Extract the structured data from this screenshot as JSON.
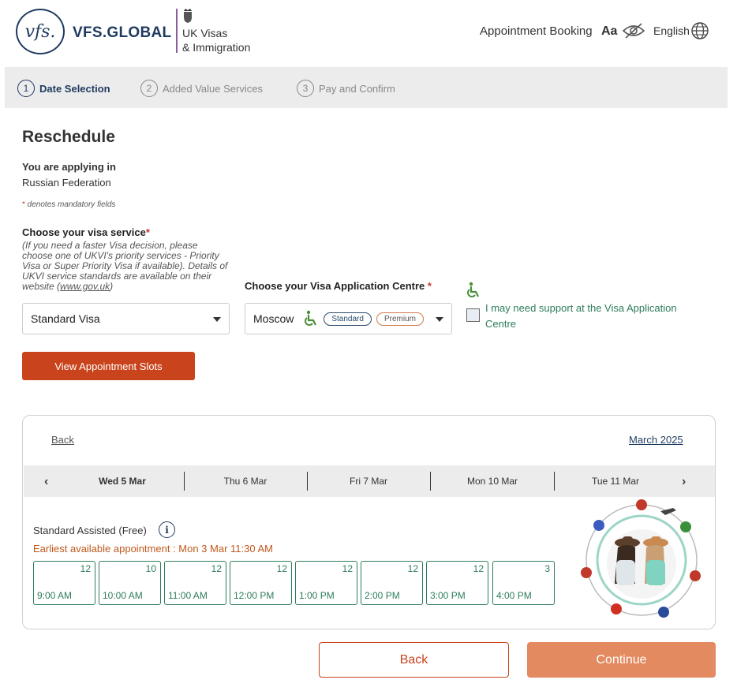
{
  "header": {
    "logo_text": "vfs.",
    "brand": "VFS.GLOBAL",
    "partner_line1": "UK Visas",
    "partner_line2": "& Immigration",
    "appointment_booking": "Appointment Booking",
    "font_size_control": "Aa",
    "language": "English"
  },
  "steps": [
    {
      "num": "1",
      "label": "Date Selection",
      "active": true
    },
    {
      "num": "2",
      "label": "Added Value Services",
      "active": false
    },
    {
      "num": "3",
      "label": "Pay and Confirm",
      "active": false
    }
  ],
  "form": {
    "title": "Reschedule",
    "applying_label": "You are applying in",
    "applying_value": "Russian Federation",
    "mandatory_star": "*",
    "mandatory_note": " denotes mandatory fields",
    "service_label": "Choose your visa service",
    "required_mark": "*",
    "service_note_pre": "(If you need a faster Visa decision, please choose one of UKVI's priority services - Priority Visa or Super Priority Visa if available). Details of UKVI service standards are available on their website (",
    "service_note_link": "www.gov.uk",
    "service_note_post": ")",
    "service_value": "Standard Visa",
    "vac_label": "Choose your Visa Application Centre",
    "vac_value": "Moscow",
    "vac_pill_standard": "Standard",
    "vac_pill_premium": "Premium",
    "support_text": "I may need support at the Visa Application Centre",
    "view_slots_button": "View Appointment Slots"
  },
  "calendar": {
    "back_link": "Back",
    "month": "March 2025",
    "days": [
      "Wed 5 Mar",
      "Thu 6 Mar",
      "Fri 7 Mar",
      "Mon 10 Mar",
      "Tue 11 Mar"
    ],
    "selected_day_index": 0,
    "category_label": "Standard Assisted (Free)",
    "info_icon_glyph": "i",
    "earliest": "Earliest available appointment : Mon 3 Mar 11:30 AM",
    "slots": [
      {
        "count": "12",
        "time": "9:00 AM"
      },
      {
        "count": "10",
        "time": "10:00 AM"
      },
      {
        "count": "12",
        "time": "11:00 AM"
      },
      {
        "count": "12",
        "time": "12:00 PM"
      },
      {
        "count": "12",
        "time": "1:00 PM"
      },
      {
        "count": "12",
        "time": "2:00 PM"
      },
      {
        "count": "12",
        "time": "3:00 PM"
      },
      {
        "count": "3",
        "time": "4:00 PM"
      }
    ]
  },
  "footer": {
    "back_button": "Back",
    "continue_button": "Continue"
  },
  "colors": {
    "brand_navy": "#1f3a5f",
    "accent_orange": "#c9441c",
    "continue_orange": "#e38a60",
    "slot_green": "#2e7d5b",
    "accessibility_green": "#4a8f3a"
  },
  "icons": [
    "vfs-logo-icon",
    "royal-crest-icon",
    "hide-eye-icon",
    "globe-icon",
    "wheelchair-icon",
    "info-icon",
    "chevron-left-icon",
    "chevron-right-icon",
    "dropdown-caret-icon",
    "travel-illustration"
  ]
}
